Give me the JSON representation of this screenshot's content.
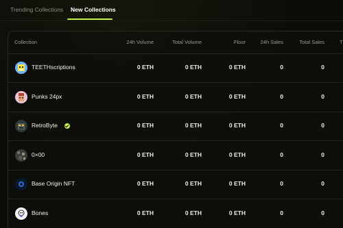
{
  "tabs": [
    {
      "label": "Trending Collections",
      "active": false
    },
    {
      "label": "New Collections",
      "active": true
    }
  ],
  "accent_color": "#c6f24e",
  "table": {
    "headers": {
      "collection": "Collection",
      "vol24": "24h Volume",
      "total_volume": "Total Volume",
      "floor": "Floor",
      "sales24": "24h Sales",
      "total_sales": "Total Sales",
      "clipped": "T"
    },
    "rows": [
      {
        "name": "TEETHscriptions",
        "icon": "teeth-avatar-icon",
        "verified": false,
        "vol24": "0 ETH",
        "total_volume": "0 ETH",
        "floor": "0 ETH",
        "sales24": "0",
        "total_sales": "0"
      },
      {
        "name": "Punks 24px",
        "icon": "punk-avatar-icon",
        "verified": false,
        "vol24": "0 ETH",
        "total_volume": "0 ETH",
        "floor": "0 ETH",
        "sales24": "0",
        "total_sales": "0"
      },
      {
        "name": "RetroByte",
        "icon": "retrobyte-avatar-icon",
        "verified": true,
        "vol24": "0 ETH",
        "total_volume": "0 ETH",
        "floor": "0 ETH",
        "sales24": "0",
        "total_sales": "0"
      },
      {
        "name": "0×00",
        "icon": "zero-avatar-icon",
        "verified": false,
        "vol24": "0 ETH",
        "total_volume": "0 ETH",
        "floor": "0 ETH",
        "sales24": "0",
        "total_sales": "0"
      },
      {
        "name": "Base Origin NFT",
        "icon": "base-origin-avatar-icon",
        "verified": false,
        "vol24": "0 ETH",
        "total_volume": "0 ETH",
        "floor": "0 ETH",
        "sales24": "0",
        "total_sales": "0"
      },
      {
        "name": "Bones",
        "icon": "bones-avatar-icon",
        "verified": false,
        "vol24": "0 ETH",
        "total_volume": "0 ETH",
        "floor": "0 ETH",
        "sales24": "0",
        "total_sales": "0"
      }
    ]
  }
}
